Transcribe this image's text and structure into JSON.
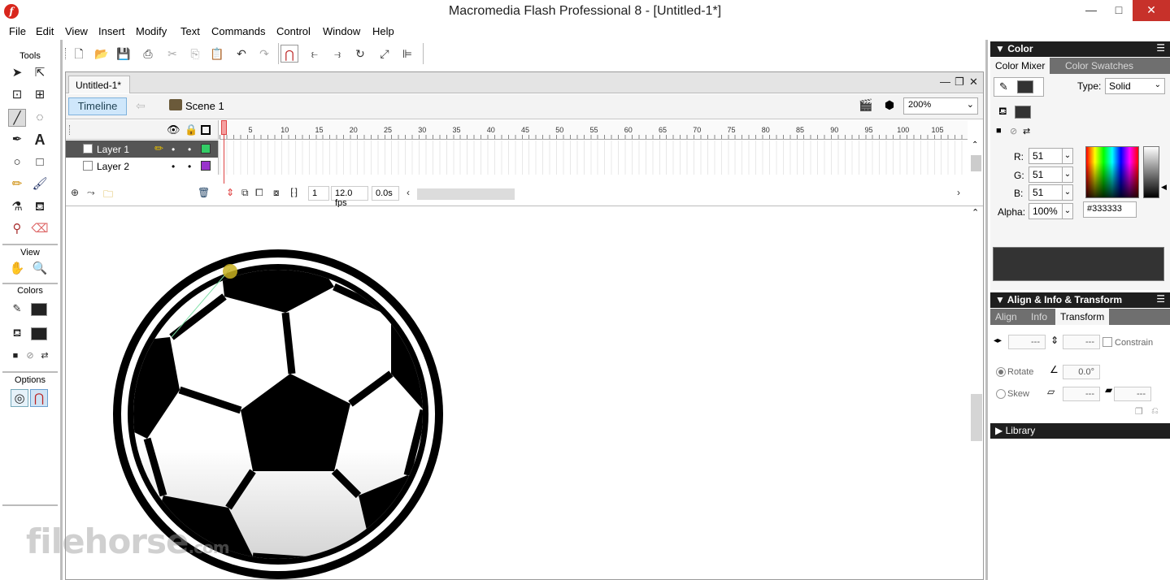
{
  "window": {
    "title": "Macromedia Flash Professional 8 - [Untitled-1*]",
    "app_icon_letter": "f",
    "controls": {
      "minimize": "—",
      "maximize": "□",
      "close": "✕"
    }
  },
  "menu": [
    "File",
    "Edit",
    "View",
    "Insert",
    "Modify",
    "Text",
    "Commands",
    "Control",
    "Window",
    "Help"
  ],
  "tools": {
    "title": "Tools",
    "view_label": "View",
    "colors_label": "Colors",
    "options_label": "Options",
    "text_tool_glyph": "A"
  },
  "document": {
    "tab_name": "Untitled-1*",
    "doc_controls": {
      "minimize": "—",
      "restore": "❐",
      "close": "✕"
    },
    "timeline_button": "Timeline",
    "scene_label": "Scene 1",
    "zoom": "200%",
    "frame_numbers": [
      "5",
      "10",
      "15",
      "20",
      "25",
      "30",
      "35",
      "40",
      "45",
      "50",
      "55",
      "60",
      "65",
      "70",
      "75",
      "80",
      "85",
      "90",
      "95",
      "100",
      "105"
    ],
    "layers": [
      {
        "name": "Layer 1",
        "color": "#33cc66",
        "active": true
      },
      {
        "name": "Layer 2",
        "color": "#9933cc",
        "active": false
      }
    ],
    "current_frame": "1",
    "frame_rate": "12.0 fps",
    "elapsed_time": "0.0s"
  },
  "color_panel": {
    "title": "Color",
    "tabs": [
      "Color Mixer",
      "Color Swatches"
    ],
    "type_label": "Type:",
    "type_value": "Solid",
    "r_label": "R:",
    "r_value": "51",
    "g_label": "G:",
    "g_value": "51",
    "b_label": "B:",
    "b_value": "51",
    "alpha_label": "Alpha:",
    "alpha_value": "100%",
    "hex_value": "#333333",
    "current_color": "#333333"
  },
  "transform_panel": {
    "title": "Align & Info & Transform",
    "tabs": [
      "Align",
      "Info",
      "Transform"
    ],
    "width_value": "---",
    "height_value": "---",
    "constrain_label": "Constrain",
    "rotate_label": "Rotate",
    "rotate_value": "0.0°",
    "skew_label": "Skew",
    "skew_h_value": "---",
    "skew_v_value": "---"
  },
  "library_panel": {
    "title": "Library"
  },
  "watermark": {
    "text": "filehorse",
    "suffix": ".com"
  }
}
